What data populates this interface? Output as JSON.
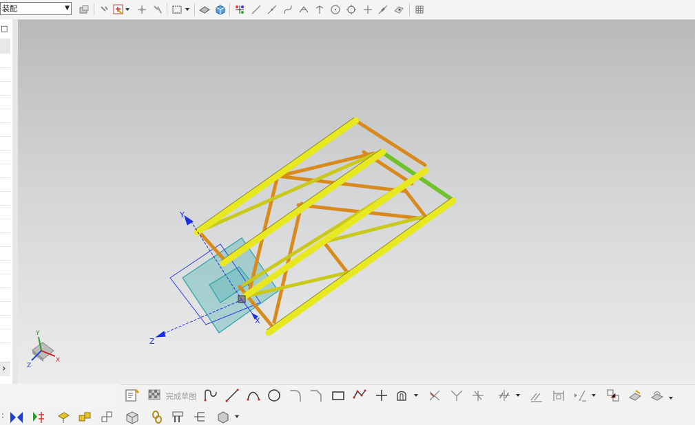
{
  "toolbar": {
    "filter_value": "装配",
    "filter_arrow": "▼"
  },
  "sketch_toolbar": {
    "finish_sketch_label": "完成草图"
  },
  "left_panel": {
    "collapse_glyph": "□",
    "scroll_glyph": "›"
  },
  "viewport": {
    "csys_axis_x": "X",
    "csys_axis_y": "Y",
    "csys_axis_z": "Z",
    "triad_x": "X",
    "triad_y": "Y",
    "triad_z": "Z"
  },
  "colors": {
    "frame_yellow": "#e8e821",
    "frame_orange": "#d98a1c",
    "highlight_green": "#6fc22a",
    "datum_teal": "#35b3b3",
    "csys_blue": "#1d2ee0"
  }
}
